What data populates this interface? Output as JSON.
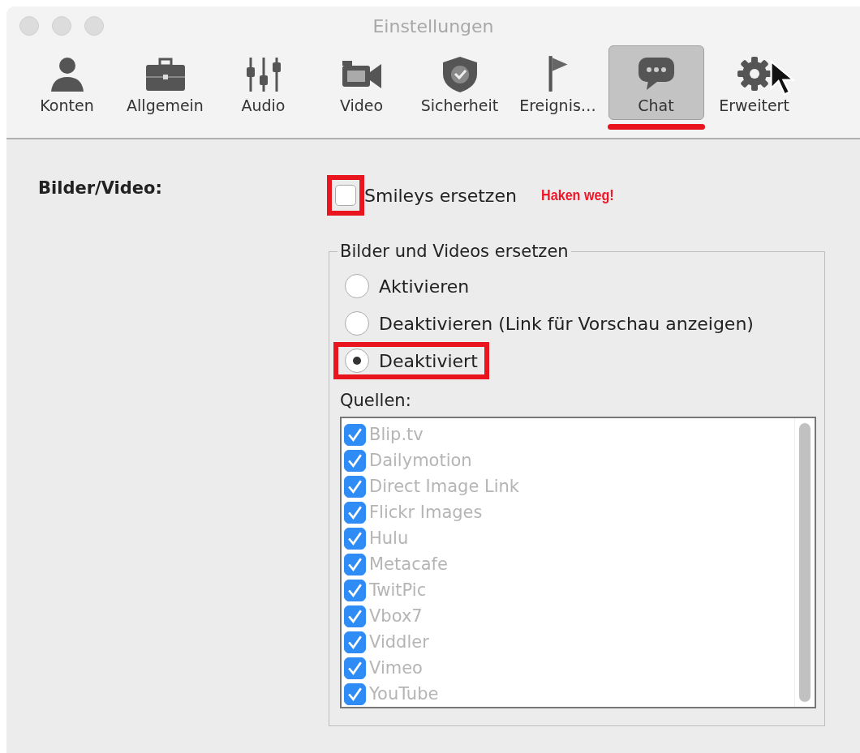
{
  "window": {
    "title": "Einstellungen"
  },
  "tabs": [
    {
      "label": "Konten",
      "selected": false,
      "underlined": false
    },
    {
      "label": "Allgemein",
      "selected": false,
      "underlined": false
    },
    {
      "label": "Audio",
      "selected": false,
      "underlined": false
    },
    {
      "label": "Video",
      "selected": false,
      "underlined": false
    },
    {
      "label": "Sicherheit",
      "selected": false,
      "underlined": false
    },
    {
      "label": "Ereignis…",
      "selected": false,
      "underlined": false
    },
    {
      "label": "Chat",
      "selected": true,
      "underlined": true
    },
    {
      "label": "Erweitert",
      "selected": false,
      "underlined": false,
      "pointer": true
    }
  ],
  "section_label": "Bilder/Video:",
  "smileys": {
    "label": "Smileys ersetzen",
    "checked": false,
    "highlighted": true
  },
  "note": "Haken weg!",
  "group": {
    "legend": "Bilder und Videos ersetzen",
    "options": [
      {
        "label": "Aktivieren",
        "selected": false,
        "highlighted": false
      },
      {
        "label": "Deaktivieren (Link für Vorschau anzeigen)",
        "selected": false,
        "highlighted": false
      },
      {
        "label": "Deaktiviert",
        "selected": true,
        "highlighted": true
      }
    ],
    "sources_label": "Quellen:",
    "sources": [
      {
        "label": "Blip.tv",
        "checked": true,
        "disabled": true
      },
      {
        "label": "Dailymotion",
        "checked": true,
        "disabled": true
      },
      {
        "label": "Direct Image Link",
        "checked": true,
        "disabled": true
      },
      {
        "label": "Flickr Images",
        "checked": true,
        "disabled": true
      },
      {
        "label": "Hulu",
        "checked": true,
        "disabled": true
      },
      {
        "label": "Metacafe",
        "checked": true,
        "disabled": true
      },
      {
        "label": "TwitPic",
        "checked": true,
        "disabled": true
      },
      {
        "label": "Vbox7",
        "checked": true,
        "disabled": true
      },
      {
        "label": "Viddler",
        "checked": true,
        "disabled": true
      },
      {
        "label": "Vimeo",
        "checked": true,
        "disabled": true
      },
      {
        "label": "YouTube",
        "checked": true,
        "disabled": true
      }
    ]
  }
}
